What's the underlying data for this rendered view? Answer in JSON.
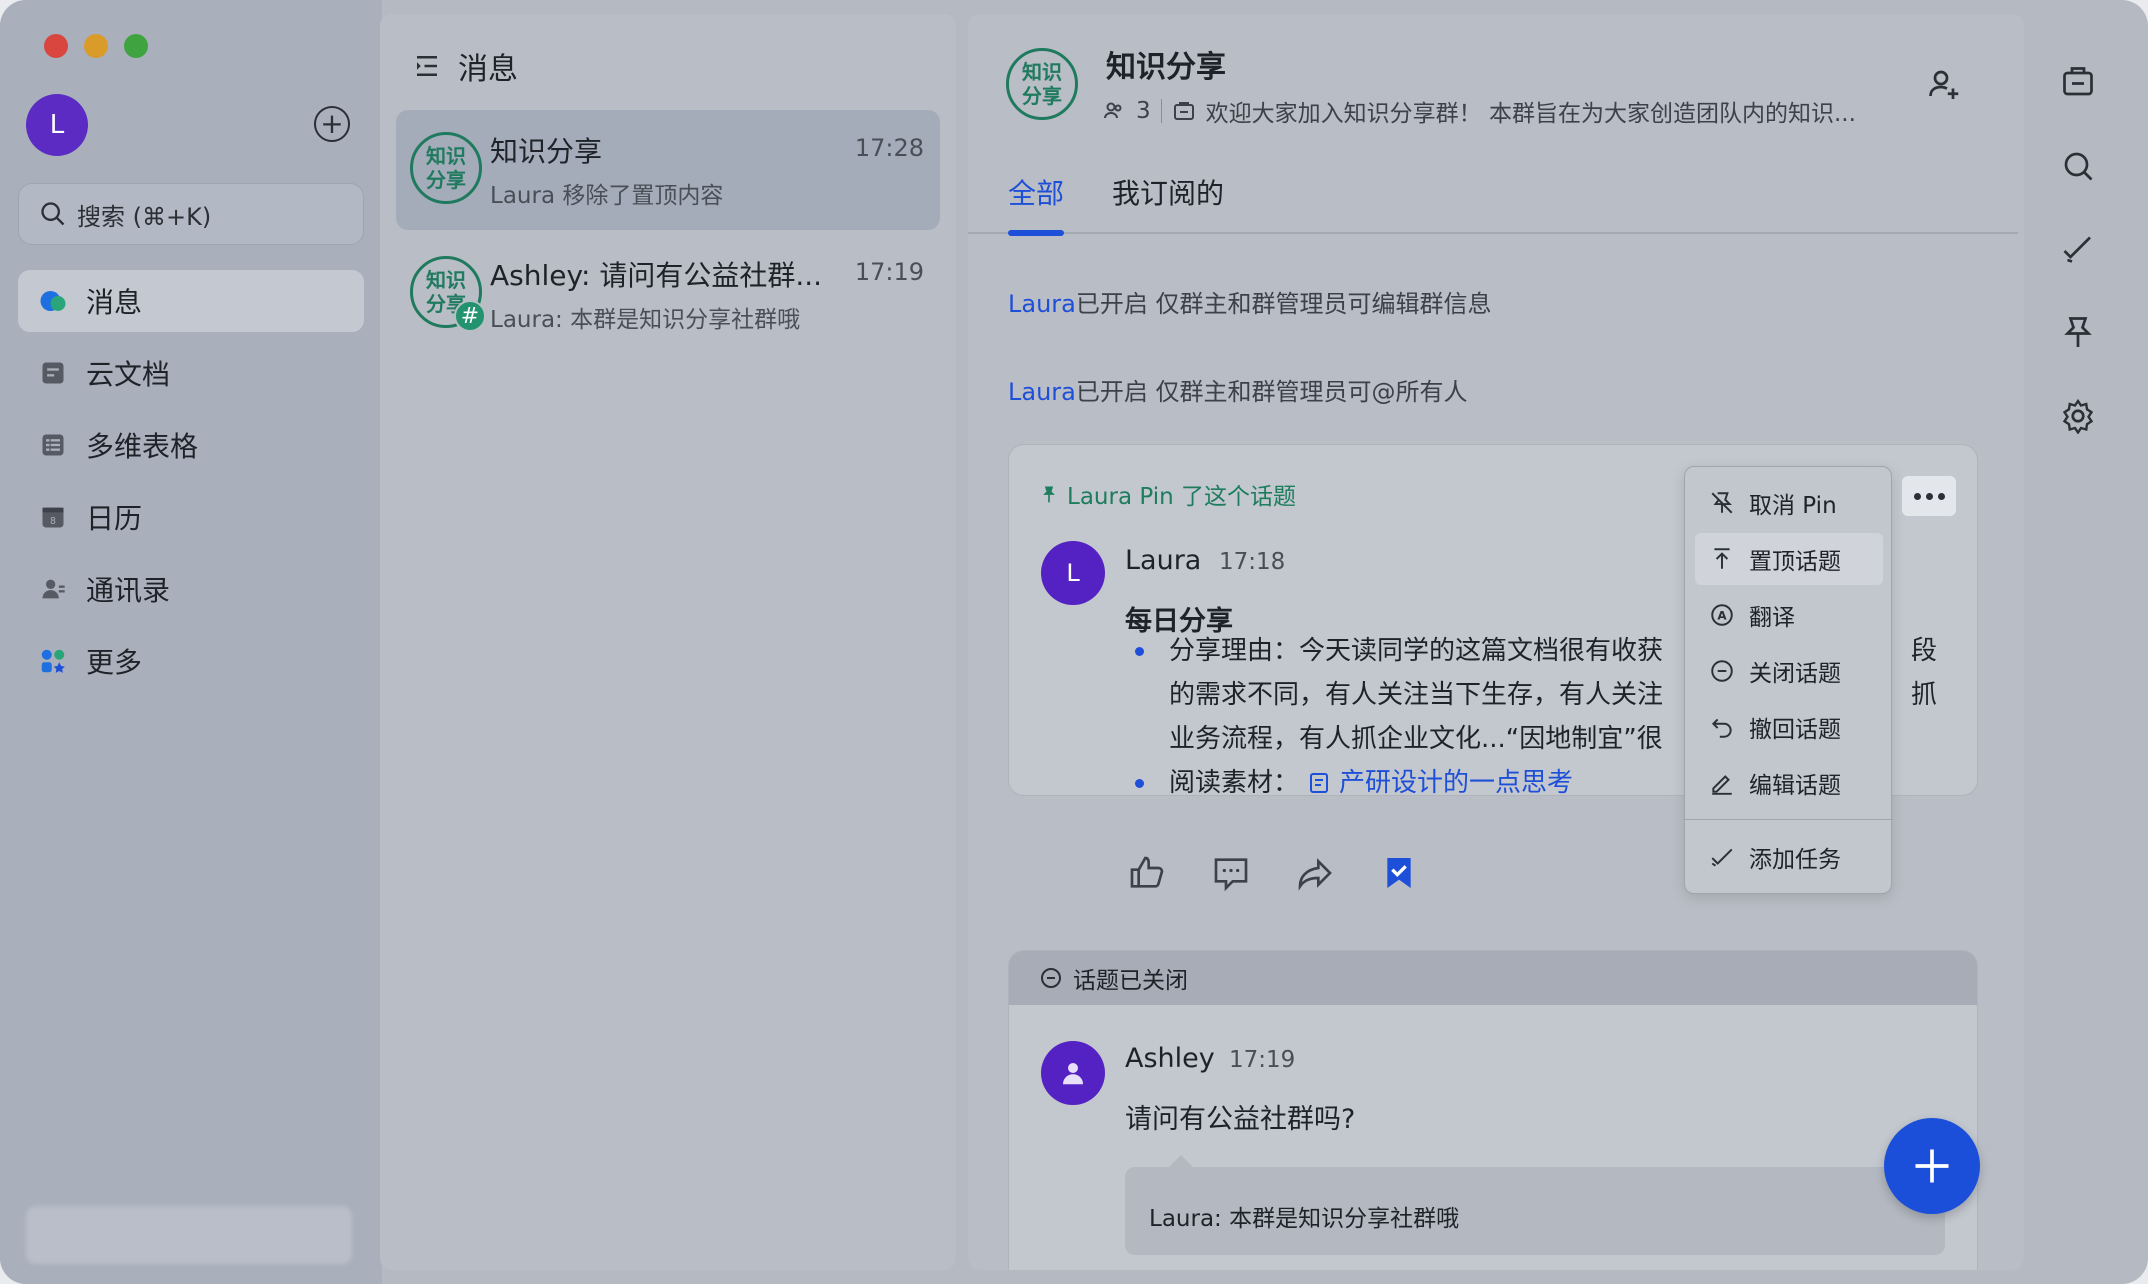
{
  "sidebar": {
    "avatar_initial": "L",
    "search_placeholder": "搜索 (⌘+K)",
    "items": [
      {
        "label": "消息",
        "icon": "message-icon",
        "active": true
      },
      {
        "label": "云文档",
        "icon": "docs-icon"
      },
      {
        "label": "多维表格",
        "icon": "table-icon"
      },
      {
        "label": "日历",
        "icon": "calendar-icon"
      },
      {
        "label": "通讯录",
        "icon": "contacts-icon"
      },
      {
        "label": "更多",
        "icon": "more-apps-icon"
      }
    ]
  },
  "chat_list": {
    "title": "消息",
    "chats": [
      {
        "avatar_text": "知识分享",
        "name": "知识分享",
        "time": "17:28",
        "preview": "Laura 移除了置顶内容"
      },
      {
        "avatar_text": "知识分享",
        "badge": "#",
        "name": "Ashley: 请问有公益社群...",
        "time": "17:19",
        "preview": "Laura: 本群是知识分享社群哦"
      }
    ]
  },
  "chat": {
    "avatar_text": "知识分享",
    "title": "知识分享",
    "member_count": "3",
    "description": "欢迎大家加入知识分享群！ 本群旨在为大家创造团队内的知识...",
    "tabs": [
      "全部",
      "我订阅的"
    ],
    "system_messages": [
      {
        "name": "Laura",
        "text": "已开启 仅群主和群管理员可编辑群信息"
      },
      {
        "name": "Laura",
        "text": "已开启 仅群主和群管理员可@所有人"
      }
    ],
    "pinned_topic": {
      "pin_note": "Laura Pin 了这个话题",
      "author": "Laura",
      "author_initial": "L",
      "time": "17:18",
      "title": "每日分享",
      "bullet1": "分享理由：今天读同学的这篇文档很有收获\n的需求不同，有人关注当下生存，有人关注\n业务流程，有人抓企业文化...“因地制宜”很",
      "bullet1_tail": [
        "段",
        "抓"
      ],
      "bullet2_label": "阅读素材：",
      "bullet2_link": "产研设计的一点思考"
    },
    "context_menu": [
      {
        "label": "取消 Pin",
        "icon": "unpin-icon"
      },
      {
        "label": "置顶话题",
        "icon": "pin-top-icon",
        "highlighted": true
      },
      {
        "label": "翻译",
        "icon": "translate-icon"
      },
      {
        "label": "关闭话题",
        "icon": "close-topic-icon"
      },
      {
        "label": "撤回话题",
        "icon": "recall-icon"
      },
      {
        "label": "编辑话题",
        "icon": "edit-icon"
      },
      {
        "label": "添加任务",
        "icon": "task-icon"
      }
    ],
    "closed_topic": {
      "status": "话题已关闭",
      "author": "Ashley",
      "time": "17:19",
      "text": "请问有公益社群吗?",
      "reply": "Laura: 本群是知识分享社群哦"
    }
  },
  "colors": {
    "accent": "#1e4fd8",
    "group_green": "#1f7a5e",
    "avatar_purple": "#5421c2"
  }
}
